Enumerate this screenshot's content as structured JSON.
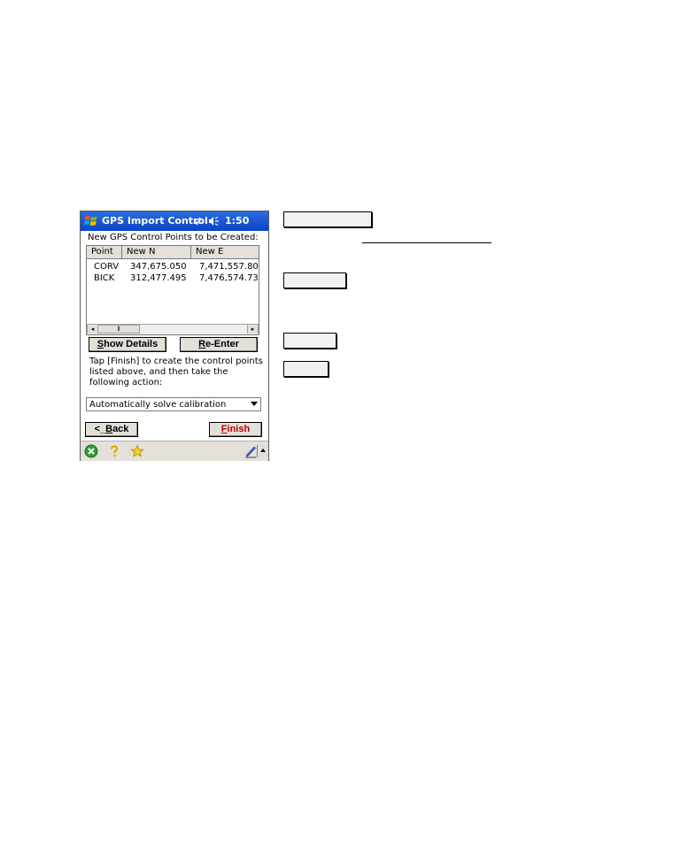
{
  "window": {
    "title": "GPS Import Control",
    "time": "1:50"
  },
  "heading": "New GPS Control Points to be Created:",
  "table": {
    "columns": [
      "Point",
      "New N",
      "New E"
    ],
    "rows": [
      [
        "CORV",
        "347,675.050",
        "7,471,557.80"
      ],
      [
        "BICK",
        "312,477.495",
        "7,476,574.73"
      ]
    ]
  },
  "scroll": {
    "left_arrow": "◂",
    "thumb_grip": "⦀",
    "right_arrow": "▸"
  },
  "buttons": {
    "show_details": {
      "hotkey": "S",
      "rest": "how Details"
    },
    "re_enter": {
      "hotkey": "R",
      "rest": "e-Enter"
    },
    "back": {
      "prefix": "<_",
      "hotkey": "B",
      "rest": "ack"
    },
    "finish": {
      "hotkey": "F",
      "rest": "inish"
    }
  },
  "instructions": "Tap [Finish] to create the control points listed above, and then take the following action:",
  "action_select": {
    "selected": "Automatically solve calibration"
  },
  "colors": {
    "titlebar": "#0a45c8",
    "finish_text": "#c00000",
    "chrome": "#e4e0d8"
  },
  "icons": {
    "start": "windows-flag-icon",
    "connectivity": "connectivity-icon",
    "volume": "volume-icon",
    "taskbar": [
      "close-circle-icon",
      "help-icon",
      "favorites-star-icon",
      "pen-input-icon"
    ]
  }
}
